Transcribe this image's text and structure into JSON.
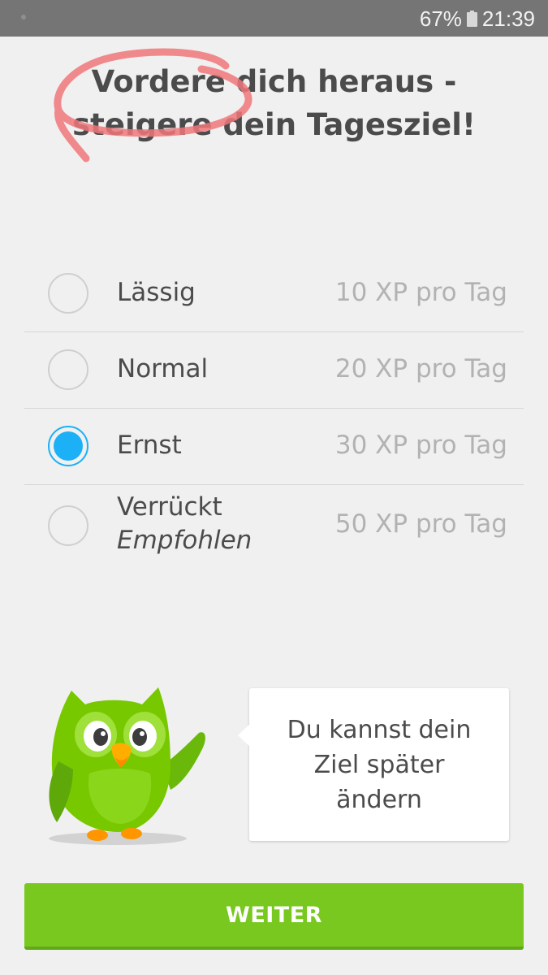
{
  "status_bar": {
    "battery": "67%",
    "time": "21:39",
    "battery_icon": "battery-icon"
  },
  "title": {
    "line1": "Vordere dich heraus -",
    "line2": "steigere dein Tagesziel!"
  },
  "options": [
    {
      "label": "Lässig",
      "sublabel": "",
      "xp": "10 XP pro Tag",
      "selected": false
    },
    {
      "label": "Normal",
      "sublabel": "",
      "xp": "20 XP pro Tag",
      "selected": false
    },
    {
      "label": "Ernst",
      "sublabel": "",
      "xp": "30 XP pro Tag",
      "selected": true
    },
    {
      "label": "Verrückt",
      "sublabel": "Empfohlen",
      "xp": "50 XP pro Tag",
      "selected": false
    }
  ],
  "bubble": {
    "line1": "Du kannst dein",
    "line2": "Ziel später",
    "line3": "ändern"
  },
  "continue_button": {
    "label": "WEITER"
  },
  "colors": {
    "accent_blue": "#1cb0f6",
    "button_green": "#78c81f",
    "owl_green": "#78c800",
    "scribble": "#f0777a"
  }
}
